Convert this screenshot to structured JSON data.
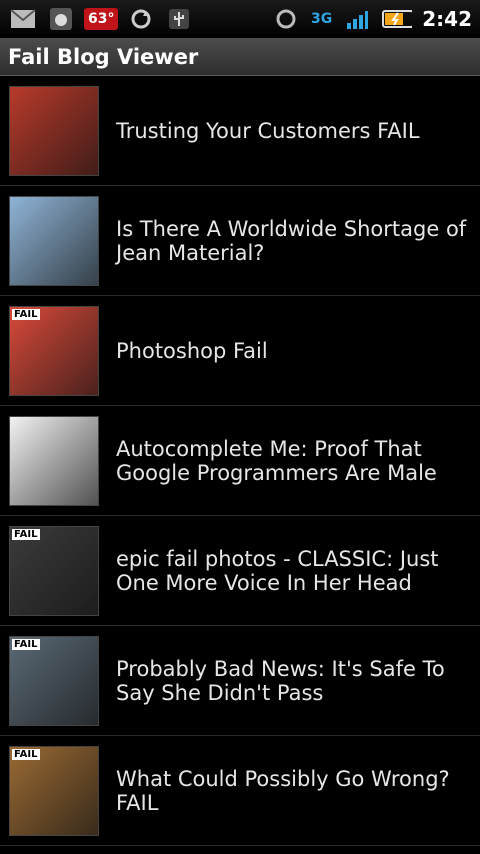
{
  "status_bar": {
    "temperature": "63°",
    "network": "3G",
    "time": "2:42"
  },
  "app": {
    "title": "Fail Blog Viewer"
  },
  "items": [
    {
      "title": "Trusting Your Customers FAIL"
    },
    {
      "title": "Is There A Worldwide Shortage of Jean Material?"
    },
    {
      "title": "Photoshop Fail"
    },
    {
      "title": "Autocomplete Me: Proof That Google Programmers Are Male"
    },
    {
      "title": "epic fail photos - CLASSIC: Just One More Voice In Her Head"
    },
    {
      "title": "Probably Bad News: It's Safe To Say She Didn't Pass"
    },
    {
      "title": "What Could Possibly Go Wrong? FAIL"
    }
  ],
  "thumb_colors": [
    "#b83a2b",
    "#8fb4d6",
    "#d94a3a",
    "#f2f2f2",
    "#3b3b3b",
    "#5b6a76",
    "#9a6a33"
  ],
  "thumb_labels": [
    "",
    "",
    "FAIL",
    "",
    "FAIL",
    "FAIL",
    "FAIL"
  ]
}
